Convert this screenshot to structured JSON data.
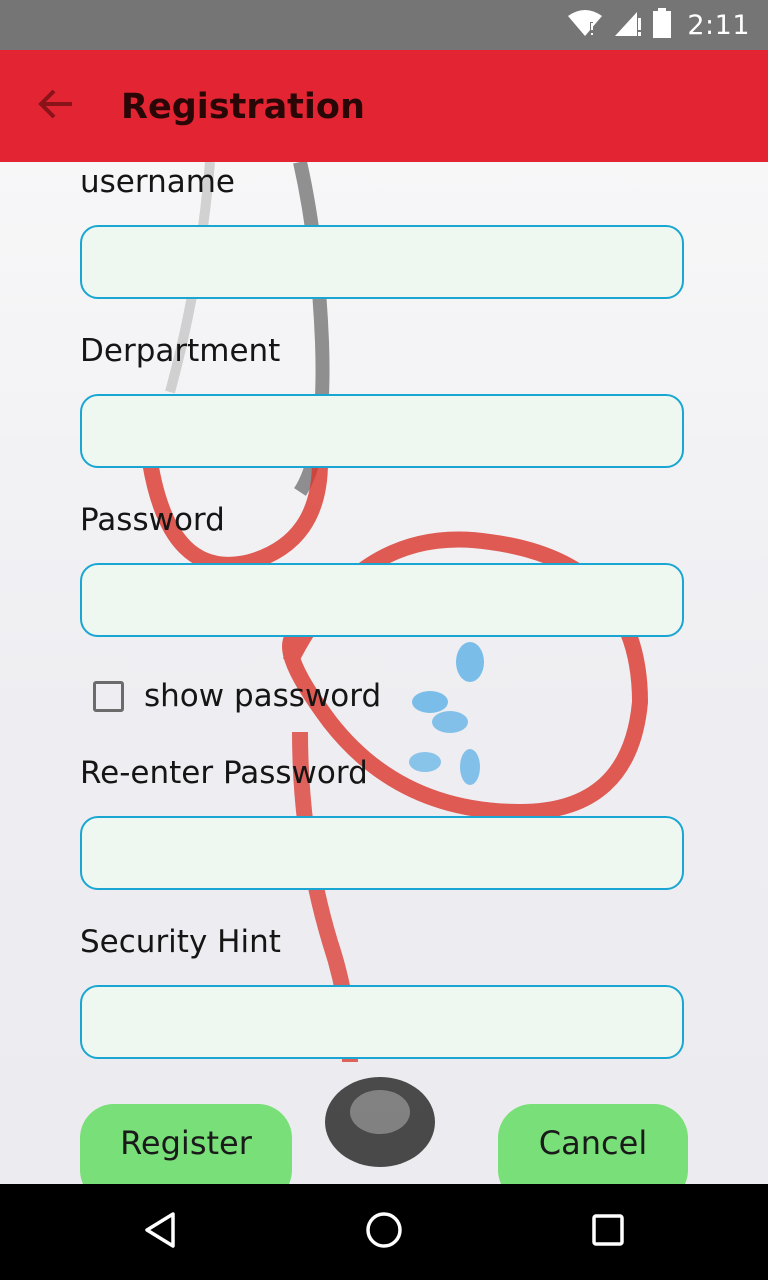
{
  "status_bar": {
    "time": "2:11",
    "icons": [
      "wifi-icon",
      "signal-icon",
      "battery-icon"
    ]
  },
  "app_bar": {
    "title": "Registration",
    "back_icon": "arrow-left-icon"
  },
  "form": {
    "fields": [
      {
        "label": "username",
        "value": ""
      },
      {
        "label": "Derpartment",
        "value": ""
      },
      {
        "label": "Password",
        "value": ""
      },
      {
        "label": "Re-enter Password",
        "value": ""
      },
      {
        "label": "Security Hint",
        "value": ""
      }
    ],
    "show_password": {
      "label": "show password",
      "checked": false
    }
  },
  "buttons": {
    "register": "Register",
    "cancel": "Cancel"
  },
  "nav_bar": {
    "icons": [
      "back-triangle-icon",
      "home-circle-icon",
      "recents-square-icon"
    ]
  },
  "colors": {
    "app_bar": "#e22433",
    "status_bar": "#757575",
    "input_border": "#1aa6d3",
    "input_fill": "#eef8f1",
    "button": "#79df78"
  }
}
